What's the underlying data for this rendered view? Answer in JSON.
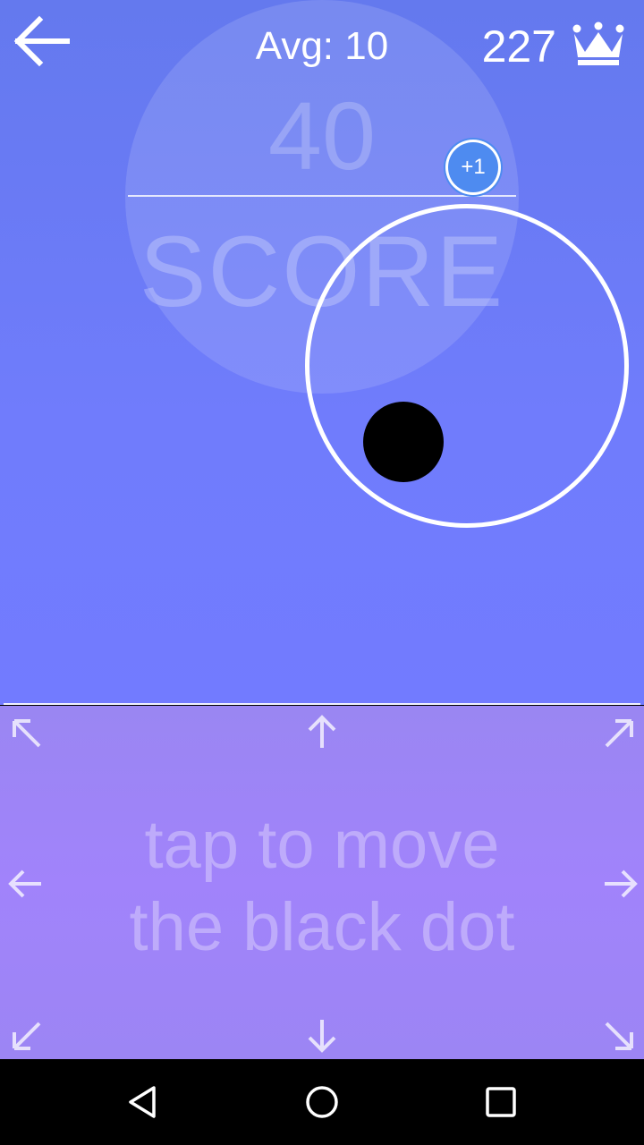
{
  "header": {
    "avg_text": "Avg: 10",
    "best_score": "227"
  },
  "score": {
    "value": "40",
    "label": "SCORE"
  },
  "badge": {
    "text": "+1"
  },
  "control": {
    "instruction_line1": "tap to move",
    "instruction_line2": "the black dot"
  },
  "icons": {
    "back": "back-arrow-icon",
    "crown": "crown-icon",
    "arrows": [
      "arrow-up-left-icon",
      "arrow-up-icon",
      "arrow-up-right-icon",
      "arrow-left-icon",
      "arrow-right-icon",
      "arrow-down-left-icon",
      "arrow-down-icon",
      "arrow-down-right-icon"
    ],
    "nav": [
      "nav-back-icon",
      "nav-home-icon",
      "nav-recents-icon"
    ]
  },
  "colors": {
    "game_bg": "#6C7BF8",
    "control_bg": "#A084F8",
    "badge": "#4E8BF0",
    "dot": "#000000"
  }
}
